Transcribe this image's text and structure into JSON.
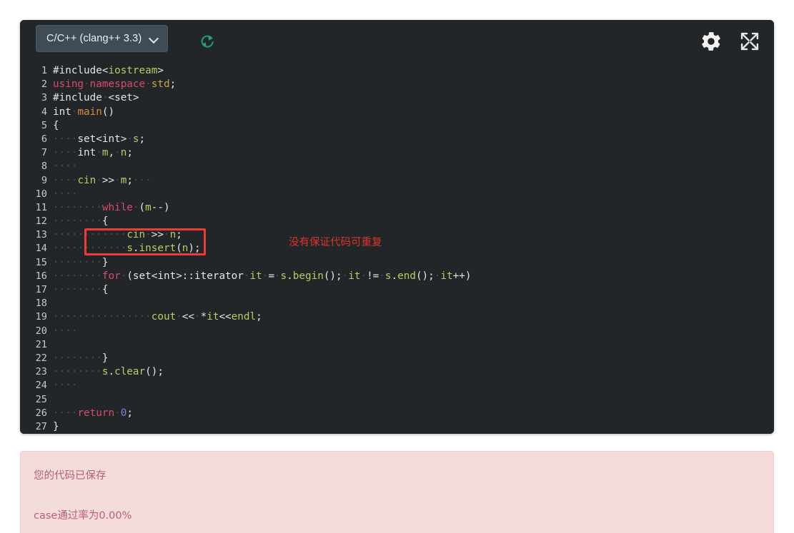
{
  "toolbar": {
    "language_label": "C/C++ (clang++ 3.3)",
    "chevron_icon": "chevron-down-icon",
    "refresh_icon": "refresh-icon",
    "settings_icon": "gear-icon",
    "fullscreen_icon": "expand-arrows-icon"
  },
  "annotation": {
    "text": "没有保证代码可重复",
    "color": "#d9352c"
  },
  "editor": {
    "language": "cpp",
    "highlight_box": {
      "line": 9,
      "color": "#ef3b36"
    },
    "lines": [
      {
        "n": "1",
        "text": "#include<iostream>"
      },
      {
        "n": "2",
        "text": "using namespace std;"
      },
      {
        "n": "3",
        "text": "#include <set>"
      },
      {
        "n": "4",
        "text": "int main()"
      },
      {
        "n": "5",
        "text": "{"
      },
      {
        "n": "6",
        "text": "    set<int> s;"
      },
      {
        "n": "7",
        "text": "    int m, n;"
      },
      {
        "n": "8",
        "text": "    "
      },
      {
        "n": "9",
        "text": "    cin >> m;   "
      },
      {
        "n": "10",
        "text": "    "
      },
      {
        "n": "11",
        "text": "        while (m--)"
      },
      {
        "n": "12",
        "text": "        {"
      },
      {
        "n": "13",
        "text": "            cin >> n;"
      },
      {
        "n": "14",
        "text": "            s.insert(n);"
      },
      {
        "n": "15",
        "text": "        }"
      },
      {
        "n": "16",
        "text": "        for (set<int>::iterator it = s.begin(); it != s.end(); it++)"
      },
      {
        "n": "17",
        "text": "        {"
      },
      {
        "n": "18",
        "text": ""
      },
      {
        "n": "19",
        "text": "                cout << *it<<endl;"
      },
      {
        "n": "20",
        "text": "    "
      },
      {
        "n": "21",
        "text": ""
      },
      {
        "n": "22",
        "text": "        }"
      },
      {
        "n": "23",
        "text": "        s.clear();"
      },
      {
        "n": "24",
        "text": "    "
      },
      {
        "n": "25",
        "text": ""
      },
      {
        "n": "26",
        "text": "    return 0;"
      },
      {
        "n": "27",
        "text": "}"
      }
    ]
  },
  "result": {
    "saved_message": "您的代码已保存",
    "pass_rate_message": "case通过率为0.00%",
    "background": "#f4dcdc",
    "text_color": "#b8606d"
  }
}
